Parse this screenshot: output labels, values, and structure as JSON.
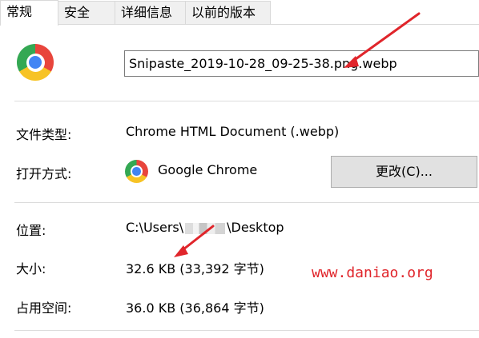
{
  "tabs": [
    {
      "label": "常规",
      "active": true
    },
    {
      "label": "安全",
      "active": false
    },
    {
      "label": "详细信息",
      "active": false
    },
    {
      "label": "以前的版本",
      "active": false
    }
  ],
  "file": {
    "icon": "chrome-icon",
    "name": "Snipaste_2019-10-28_09-25-38.png.webp"
  },
  "properties": {
    "type_label": "文件类型:",
    "type_value": "Chrome HTML Document (.webp)",
    "open_with_label": "打开方式:",
    "open_with_app": "Google Chrome",
    "change_button": "更改(C)...",
    "location_label": "位置:",
    "location_prefix": "C:\\Users\\",
    "location_suffix": "\\Desktop",
    "size_label": "大小:",
    "size_value": "32.6 KB (33,392 字节)",
    "disk_label": "占用空间:",
    "disk_value": "36.0 KB (36,864 字节)"
  },
  "watermark": "www.daniao.org",
  "colors": {
    "annotation": "#e0252b",
    "tab_inactive": "#f0f0f0",
    "button": "#e1e1e1"
  }
}
